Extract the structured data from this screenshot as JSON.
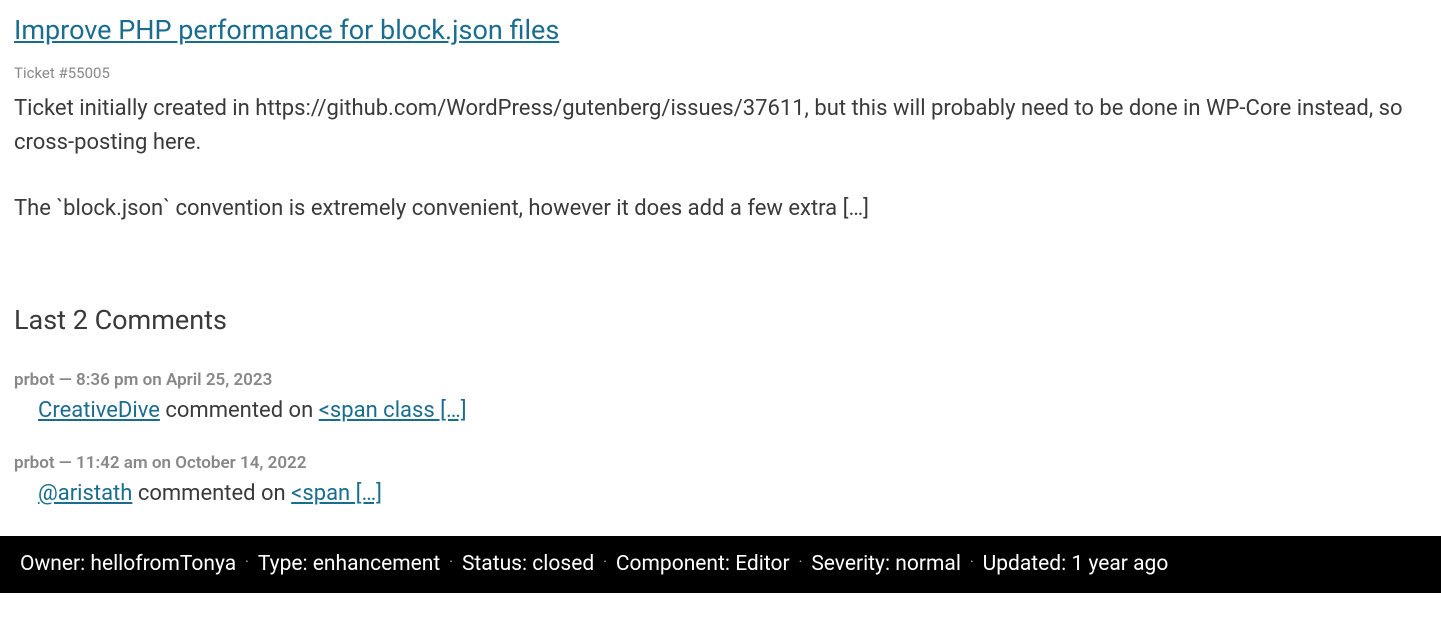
{
  "ticket": {
    "title": "Improve PHP performance for block.json files",
    "number": "Ticket #55005",
    "description_p1": "Ticket initially created in https://github.com/WordPress/gutenberg/issues/37611, but this will probably need to be done in WP-Core instead, so cross-posting here.",
    "description_p2": "The `block.json` convention is extremely convenient, however it does add a few extra […]"
  },
  "comments": {
    "heading": "Last 2 Comments",
    "items": [
      {
        "meta": "prbot — 8:36 pm on April 25, 2023",
        "author_link": "CreativeDive",
        "middle_text": " commented on ",
        "snippet_link": "<span class […]"
      },
      {
        "meta": "prbot — 11:42 am on October 14, 2022",
        "author_link": "@aristath",
        "middle_text": " commented on ",
        "snippet_link": "<span […]"
      }
    ]
  },
  "footer": {
    "owner_label": "Owner: ",
    "owner_value": "hellofromTonya",
    "type_label": "Type: ",
    "type_value": "enhancement",
    "status_label": "Status: ",
    "status_value": "closed",
    "component_label": "Component: ",
    "component_value": "Editor",
    "severity_label": "Severity: ",
    "severity_value": "normal",
    "updated_label": "Updated: ",
    "updated_value": "1 year ago",
    "separator": "·"
  }
}
